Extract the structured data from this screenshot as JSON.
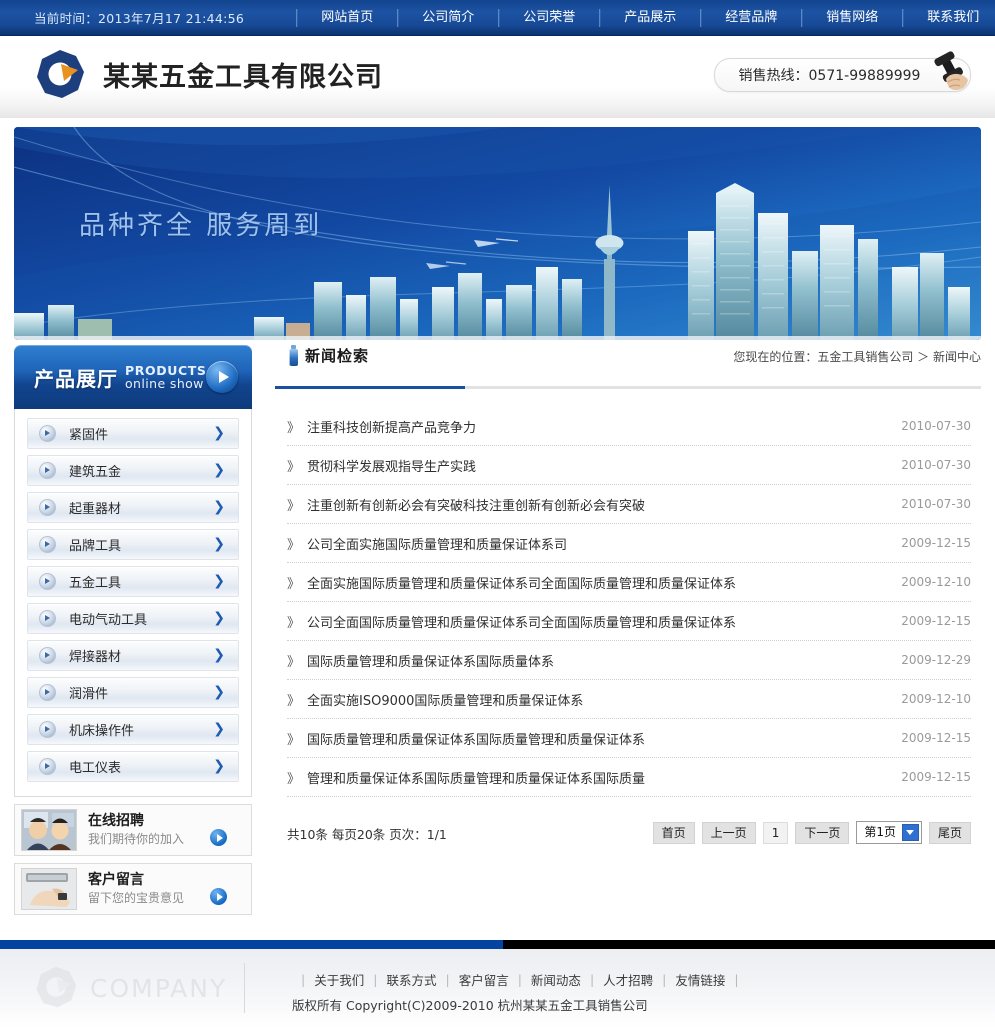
{
  "topnav": {
    "clock": "当前时间：2013年7月17 21:44:56",
    "items": [
      {
        "label": "网站首页",
        "name": "nav-item-home"
      },
      {
        "label": "公司简介",
        "name": "nav-item-about"
      },
      {
        "label": "公司荣誉",
        "name": "nav-item-honor"
      },
      {
        "label": "产品展示",
        "name": "nav-item-products"
      },
      {
        "label": "经营品牌",
        "name": "nav-item-brands"
      },
      {
        "label": "销售网络",
        "name": "nav-item-network"
      },
      {
        "label": "联系我们",
        "name": "nav-item-contact"
      }
    ]
  },
  "header": {
    "company_name": "某某五金工具有限公司",
    "hotline": "销售热线：0571-99889999"
  },
  "banner": {
    "slogan": "品种齐全 服务周到"
  },
  "sidebar": {
    "panel_title_cn": "产品展厅",
    "panel_title_en": "PRODUCTS",
    "panel_title_en2": "online show",
    "categories": [
      {
        "label": "紧固件"
      },
      {
        "label": "建筑五金"
      },
      {
        "label": "起重器材"
      },
      {
        "label": "品牌工具"
      },
      {
        "label": "五金工具"
      },
      {
        "label": "电动气动工具"
      },
      {
        "label": "焊接器材"
      },
      {
        "label": "润滑件"
      },
      {
        "label": "机床操作件"
      },
      {
        "label": "电工仪表"
      }
    ],
    "promos": [
      {
        "title": "在线招聘",
        "sub": "我们期待你的加入"
      },
      {
        "title": "客户留言",
        "sub": "留下您的宝贵意见"
      }
    ]
  },
  "content": {
    "title": "新闻检索",
    "breadcrumb": "您现在的位置：五金工具销售公司 ＞ 新闻中心",
    "arrow_glyph": "》",
    "news": [
      {
        "title": "注重科技创新提高产品竞争力",
        "date": "2010-07-30"
      },
      {
        "title": "贯彻科学发展观指导生产实践",
        "date": "2010-07-30"
      },
      {
        "title": "注重创新有创新必会有突破科技注重创新有创新必会有突破",
        "date": "2010-07-30"
      },
      {
        "title": "公司全面实施国际质量管理和质量保证体系司",
        "date": "2009-12-15"
      },
      {
        "title": "全面实施国际质量管理和质量保证体系司全面国际质量管理和质量保证体系",
        "date": "2009-12-10"
      },
      {
        "title": "公司全面国际质量管理和质量保证体系司全面国际质量管理和质量保证体系",
        "date": "2009-12-15"
      },
      {
        "title": "国际质量管理和质量保证体系国际质量体系",
        "date": "2009-12-29"
      },
      {
        "title": "全面实施ISO9000国际质量管理和质量保证体系",
        "date": "2009-12-10"
      },
      {
        "title": "国际质量管理和质量保证体系国际质量管理和质量保证体系",
        "date": "2009-12-15"
      },
      {
        "title": "管理和质量保证体系国际质量管理和质量保证体系国际质量",
        "date": "2009-12-15"
      }
    ],
    "pager": {
      "info": "共10条 每页20条 页次：1/1",
      "first": "首页",
      "prev": "上一页",
      "current": "1",
      "next": "下一页",
      "select_value": "第1页",
      "last": "尾页"
    }
  },
  "footer": {
    "watermark": "COMPANY",
    "links": [
      "关于我们",
      "联系方式",
      "客户留言",
      "新闻动态",
      "人才招聘",
      "友情链接"
    ],
    "copyright": "版权所有  Copyright(C)2009-2010 杭州某某五金工具销售公司"
  },
  "colors": {
    "nav_blue": "#1d53a3",
    "accent_blue": "#0344a0",
    "banner_blue": "#0f3f96",
    "logo_navy": "#1d3f7e",
    "logo_orange": "#e8921f"
  }
}
